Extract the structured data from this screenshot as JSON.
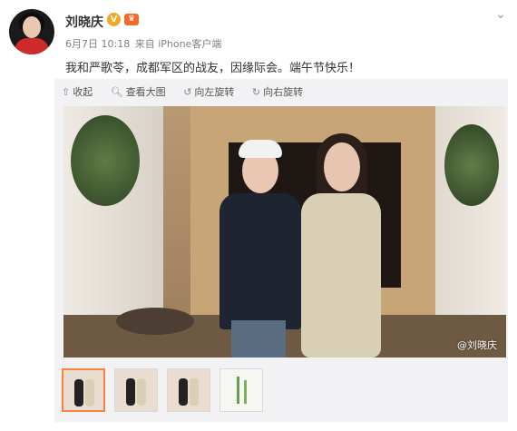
{
  "post": {
    "author": "刘晓庆",
    "verified_badge": "V",
    "time": "6月7日 10:18",
    "source": "来自 iPhone客户端",
    "text": "我和严歌苓，成都军区的战友，因缘际会。端午节快乐！"
  },
  "toolbar": {
    "collapse": "收起",
    "view_large": "查看大图",
    "rotate_left": "向左旋转",
    "rotate_right": "向右旋转"
  },
  "image": {
    "watermark": "@刘晓庆"
  },
  "thumbnails": [
    {
      "selected": true
    },
    {
      "selected": false
    },
    {
      "selected": false
    },
    {
      "selected": false
    }
  ]
}
